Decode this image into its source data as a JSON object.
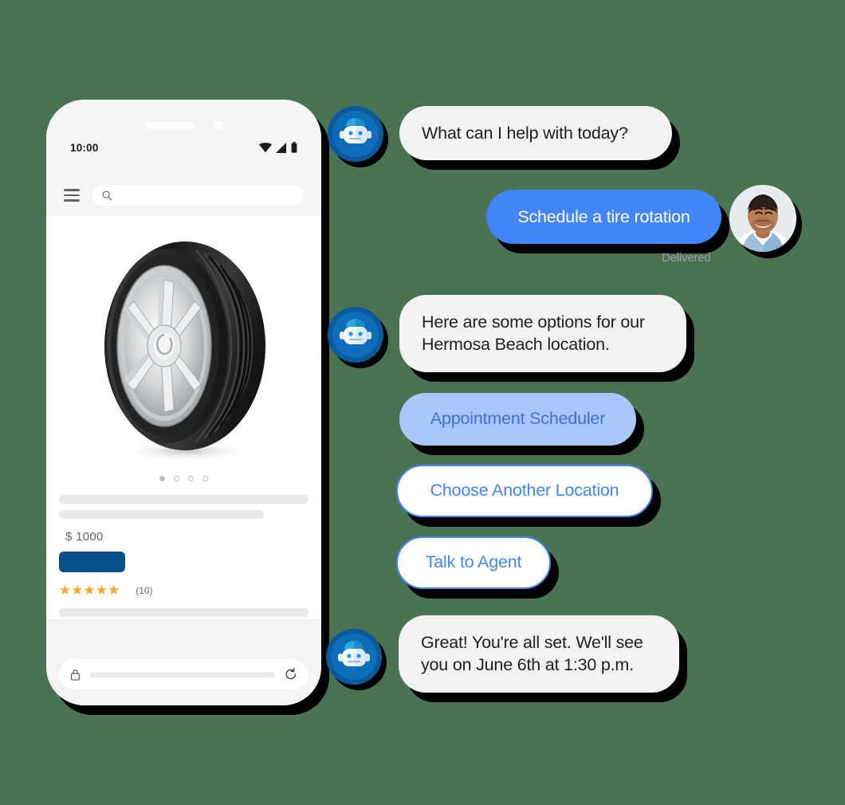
{
  "background_color": "#4a7351",
  "phone": {
    "status_bar": {
      "time": "10:00",
      "icons": [
        "wifi-icon",
        "signal-icon",
        "battery-icon"
      ]
    },
    "browser": {
      "menu_icon": "hamburger-menu-icon",
      "search_icon": "search-icon",
      "search_placeholder": "",
      "address_bar": {
        "lock_icon": "lock-icon",
        "refresh_icon": "refresh-icon",
        "url_value": ""
      }
    },
    "product": {
      "image_alt": "car-tire-with-alloy-wheel",
      "carousel_dots": 4,
      "carousel_active_index": 0,
      "price": "$ 1000",
      "cta_label": "",
      "stars": 5,
      "star_glyph": "★",
      "review_count": "(10)"
    }
  },
  "chat": {
    "messages": [
      {
        "id": "bot-greeting",
        "sender": "bot",
        "text": "What can I help with today?"
      },
      {
        "id": "user-request",
        "sender": "user",
        "text": "Schedule a tire rotation",
        "status": "Delivered"
      },
      {
        "id": "bot-options",
        "sender": "bot",
        "text": "Here are some options for our Hermosa Beach location."
      },
      {
        "id": "bot-confirm",
        "sender": "bot",
        "text": "Great! You're all set. We'll see you on June 6th at 1:30 p.m."
      }
    ],
    "chips": [
      {
        "id": "chip-appointment-scheduler",
        "label": "Appointment Scheduler",
        "style": "filled"
      },
      {
        "id": "chip-choose-another-location",
        "label": "Choose Another Location",
        "style": "outline"
      },
      {
        "id": "chip-talk-to-agent",
        "label": "Talk to Agent",
        "style": "outline"
      }
    ],
    "avatars": {
      "bot": "robot-avatar-icon",
      "user": "user-photo-avatar"
    },
    "colors": {
      "user_bubble": "#4285f4",
      "bot_bubble": "#f1f2f3",
      "chip_accent": "#4285f4",
      "chip_filled": "#a8c7fa",
      "shadow": "#000000"
    }
  }
}
